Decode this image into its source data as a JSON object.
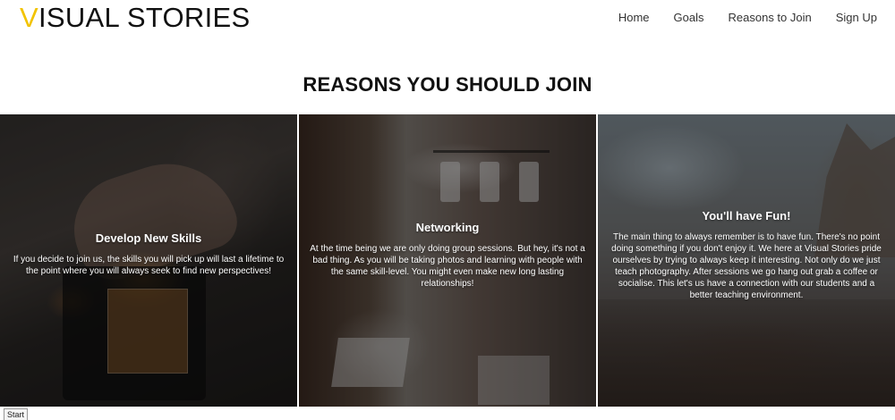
{
  "header": {
    "logo_accent": "V",
    "logo_rest": "ISUAL STORIES",
    "nav": [
      {
        "label": "Home"
      },
      {
        "label": "Goals"
      },
      {
        "label": "Reasons to Join"
      },
      {
        "label": "Sign Up"
      }
    ]
  },
  "section": {
    "title": "REASONS YOU SHOULD JOIN"
  },
  "cards": [
    {
      "title": "Develop New Skills",
      "text": "If you decide to join us, the skills you will pick up will last a lifetime to the point where you will always seek to find new perspectives!"
    },
    {
      "title": "Networking",
      "text": "At the time being we are only doing group sessions. But hey, it's not a bad thing. As you will be taking photos and learning with people with the same skill-level. You might even make new long lasting relationships!"
    },
    {
      "title": "You'll have Fun!",
      "text": "The main thing to always remember is to have fun. There's no point doing something if you don't enjoy it. We here at Visual Stories pride ourselves by trying to always keep it interesting. Not only do we just teach photography. After sessions we go hang out grab a coffee or socialise. This let's us have a connection with our students and a better teaching environment."
    }
  ],
  "footer": {
    "start_label": "Start"
  },
  "colors": {
    "accent": "#f2c300",
    "text": "#111111"
  }
}
